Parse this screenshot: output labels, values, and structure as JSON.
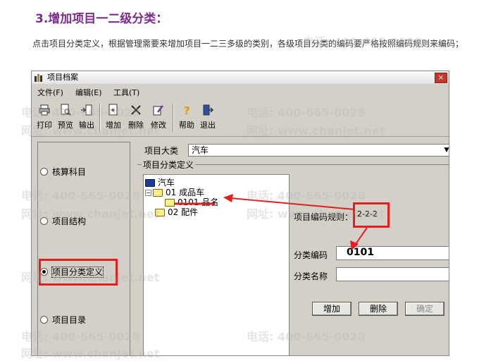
{
  "article": {
    "heading": "3.增加项目一二级分类：",
    "paragraph": "点击项目分类定义，根据管理需要来增加项目一二三多级的类别，各级项目分类的编码要严格按照编码规则来编码；"
  },
  "window": {
    "title": "项目档案",
    "close_label": "×"
  },
  "menu": [
    "文件(F)",
    "编辑(E)",
    "工具(T)"
  ],
  "toolbar": [
    "打印",
    "预览",
    "输出",
    "增加",
    "删除",
    "修改",
    "帮助",
    "退出"
  ],
  "left_panel": {
    "options": [
      {
        "label": "核算科目",
        "selected": false
      },
      {
        "label": "项目结构",
        "selected": false
      },
      {
        "label": "项目分类定义",
        "selected": true
      },
      {
        "label": "项目目录",
        "selected": false
      }
    ]
  },
  "form": {
    "category_label": "项目大类",
    "category_value": "汽车",
    "group_title": "项目分类定义",
    "code_rule_label": "项目编码规则：",
    "code_rule_value": "2-2-2",
    "class_code_label": "分类编码",
    "class_code_value": "0101",
    "class_name_label": "分类名称",
    "class_name_value": ""
  },
  "tree": {
    "root": "汽车",
    "nodes": [
      {
        "label": "01 成品车"
      },
      {
        "label": "0101 品名"
      },
      {
        "label": "02 配件"
      }
    ]
  },
  "buttons": {
    "add": "增加",
    "delete": "删除",
    "confirm": "确定"
  },
  "watermarks": [
    "电话: 400-665-0028",
    "网址: www.chanjet.net"
  ],
  "colors": {
    "heading": "#7c2d8c",
    "highlight": "#e02020"
  }
}
